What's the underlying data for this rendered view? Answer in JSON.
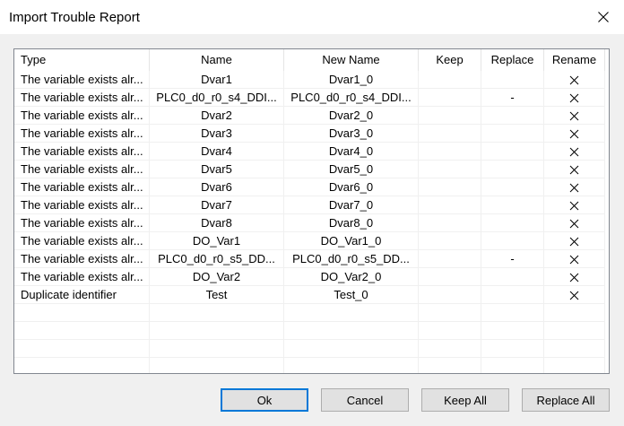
{
  "window": {
    "title": "Import Trouble Report"
  },
  "table": {
    "headers": {
      "type": "Type",
      "name": "Name",
      "new_name": "New Name",
      "keep": "Keep",
      "replace": "Replace",
      "rename": "Rename"
    },
    "rows": [
      {
        "type": "The variable exists alr...",
        "name": "Dvar1",
        "new_name": "Dvar1_0",
        "keep": "",
        "replace": "",
        "rename": true
      },
      {
        "type": "The variable exists alr...",
        "name": "PLC0_d0_r0_s4_DDI...",
        "new_name": "PLC0_d0_r0_s4_DDI...",
        "keep": "",
        "replace": "-",
        "rename": true
      },
      {
        "type": "The variable exists alr...",
        "name": "Dvar2",
        "new_name": "Dvar2_0",
        "keep": "",
        "replace": "",
        "rename": true
      },
      {
        "type": "The variable exists alr...",
        "name": "Dvar3",
        "new_name": "Dvar3_0",
        "keep": "",
        "replace": "",
        "rename": true
      },
      {
        "type": "The variable exists alr...",
        "name": "Dvar4",
        "new_name": "Dvar4_0",
        "keep": "",
        "replace": "",
        "rename": true
      },
      {
        "type": "The variable exists alr...",
        "name": "Dvar5",
        "new_name": "Dvar5_0",
        "keep": "",
        "replace": "",
        "rename": true
      },
      {
        "type": "The variable exists alr...",
        "name": "Dvar6",
        "new_name": "Dvar6_0",
        "keep": "",
        "replace": "",
        "rename": true
      },
      {
        "type": "The variable exists alr...",
        "name": "Dvar7",
        "new_name": "Dvar7_0",
        "keep": "",
        "replace": "",
        "rename": true
      },
      {
        "type": "The variable exists alr...",
        "name": "Dvar8",
        "new_name": "Dvar8_0",
        "keep": "",
        "replace": "",
        "rename": true
      },
      {
        "type": "The variable exists alr...",
        "name": "DO_Var1",
        "new_name": "DO_Var1_0",
        "keep": "",
        "replace": "",
        "rename": true
      },
      {
        "type": "The variable exists alr...",
        "name": "PLC0_d0_r0_s5_DD...",
        "new_name": "PLC0_d0_r0_s5_DD...",
        "keep": "",
        "replace": "-",
        "rename": true
      },
      {
        "type": "The variable exists alr...",
        "name": "DO_Var2",
        "new_name": "DO_Var2_0",
        "keep": "",
        "replace": "",
        "rename": true
      },
      {
        "type": "Duplicate identifier",
        "name": "Test",
        "new_name": "Test_0",
        "keep": "",
        "replace": "",
        "rename": true
      }
    ],
    "empty_rows": 4
  },
  "buttons": {
    "ok": "Ok",
    "cancel": "Cancel",
    "keep_all": "Keep All",
    "replace_all": "Replace All"
  }
}
